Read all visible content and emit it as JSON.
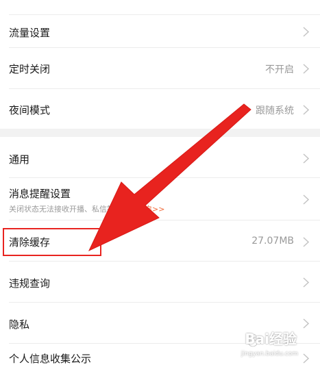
{
  "settings": {
    "group1": [
      {
        "title": "流量设置",
        "value": ""
      },
      {
        "title": "定时关闭",
        "value": "不开启"
      },
      {
        "title": "夜间模式",
        "value": "跟随系统"
      }
    ],
    "group2": {
      "general": {
        "title": "通用"
      },
      "notifications": {
        "title": "消息提醒设置",
        "subtitle": "关闭状态无法接收开播、私信等",
        "subtitle_link": "请前往开启>>"
      },
      "clear_cache": {
        "title": "清除缓存",
        "value": "27.07MB"
      },
      "violation": {
        "title": "违规查询"
      },
      "privacy": {
        "title": "隐私"
      },
      "personal_info": {
        "title": "个人信息收集公示"
      }
    }
  },
  "annotation": {
    "highlight_color": "#e8231f",
    "arrow_color": "#e8231f"
  },
  "watermark": {
    "brand": "Bai",
    "brand_suffix": "经验",
    "domain": "jingyan.baidu.com"
  }
}
